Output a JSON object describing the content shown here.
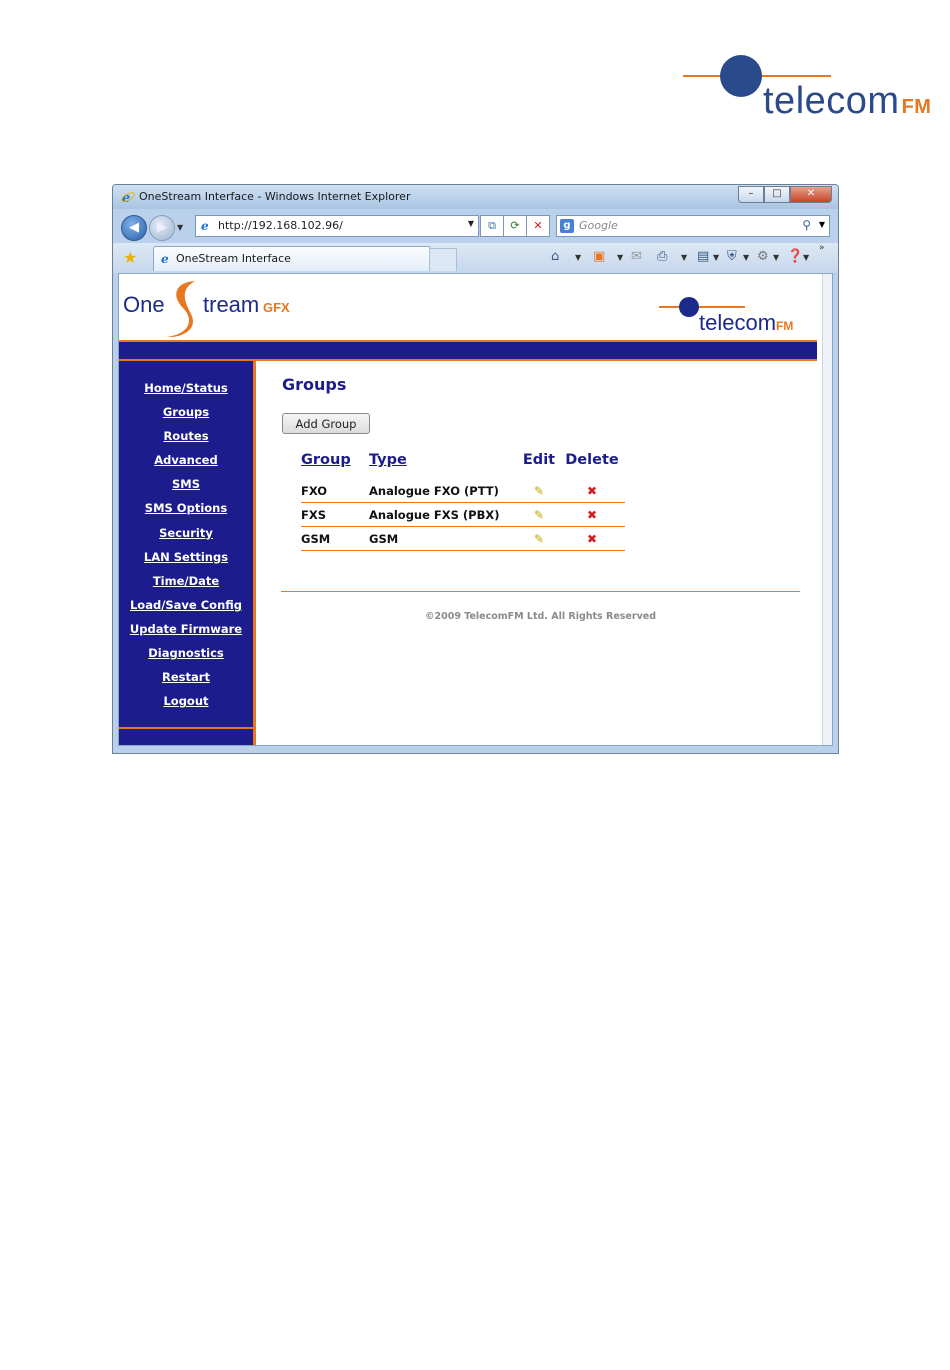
{
  "page_logo": {
    "word": "telecom",
    "suffix": "FM"
  },
  "window": {
    "title": "OneStream Interface - Windows Internet Explorer",
    "controls": {
      "minimize": "–",
      "maximize": "□",
      "close": "✕"
    }
  },
  "address_bar": {
    "url": "http://192.168.102.96/",
    "search_placeholder": "Google"
  },
  "tab": {
    "label": "OneStream Interface"
  },
  "site": {
    "logo_one": "One",
    "logo_stream": "tream",
    "logo_gfx": "GFX",
    "partner_word": "telecom",
    "partner_suffix": "FM"
  },
  "sidebar": {
    "items": [
      {
        "label": "Home/Status"
      },
      {
        "label": "Groups"
      },
      {
        "label": "Routes"
      },
      {
        "label": "Advanced"
      },
      {
        "label": "SMS"
      },
      {
        "label": "SMS Options"
      },
      {
        "label": "Security"
      },
      {
        "label": "LAN Settings"
      },
      {
        "label": "Time/Date"
      },
      {
        "label": "Load/Save Config"
      },
      {
        "label": "Update Firmware"
      },
      {
        "label": "Diagnostics"
      },
      {
        "label": "Restart"
      },
      {
        "label": "Logout"
      }
    ]
  },
  "main": {
    "heading": "Groups",
    "add_button": "Add Group",
    "table": {
      "headers": {
        "group": "Group",
        "type": "Type",
        "edit": "Edit",
        "delete": "Delete"
      },
      "rows": [
        {
          "group": "FXO",
          "type": "Analogue FXO (PTT)"
        },
        {
          "group": "FXS",
          "type": "Analogue FXS (PBX)"
        },
        {
          "group": "GSM",
          "type": "GSM"
        }
      ]
    },
    "copyright": "©2009 TelecomFM Ltd. All Rights Reserved"
  },
  "icons": {
    "edit": "pencil-icon",
    "delete": "delete-x-icon"
  },
  "colors": {
    "navy": "#1c1c8c",
    "orange": "#e87722",
    "brand_blue": "#2a4a8c"
  }
}
